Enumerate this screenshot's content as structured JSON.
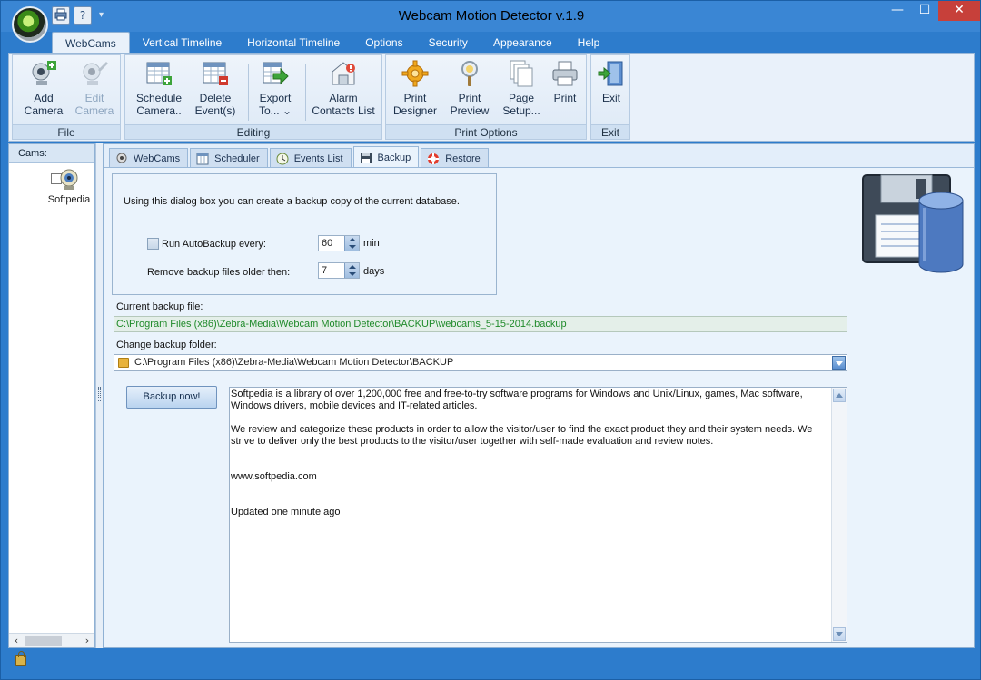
{
  "window": {
    "title": "Webcam Motion Detector v.1.9"
  },
  "quick_access": {
    "print_icon": "printer-icon",
    "help_glyph": "?",
    "dropdown_glyph": "▾"
  },
  "window_controls": {
    "minimize": "—",
    "maximize": "☐",
    "close": "✕"
  },
  "ribbon_tabs": [
    {
      "label": "WebCams",
      "active": true
    },
    {
      "label": "Vertical Timeline",
      "active": false
    },
    {
      "label": "Horizontal Timeline",
      "active": false
    },
    {
      "label": "Options",
      "active": false
    },
    {
      "label": "Security",
      "active": false
    },
    {
      "label": "Appearance",
      "active": false
    },
    {
      "label": "Help",
      "active": false
    }
  ],
  "ribbon": {
    "groups": {
      "file": "File",
      "editing": "Editing",
      "print_options": "Print Options",
      "exit": "Exit"
    },
    "buttons": {
      "add_camera": {
        "line1": "Add",
        "line2": "Camera"
      },
      "edit_camera": {
        "line1": "Edit",
        "line2": "Camera"
      },
      "schedule_camera": {
        "line1": "Schedule",
        "line2": "Camera.."
      },
      "delete_events": {
        "line1": "Delete",
        "line2": "Event(s) ⌄"
      },
      "export_to": {
        "line1": "Export",
        "line2": "To... ⌄"
      },
      "alarm_contacts": {
        "line1": "Alarm",
        "line2": "Contacts List"
      },
      "print_designer": {
        "line1": "Print",
        "line2": "Designer"
      },
      "print_preview": {
        "line1": "Print",
        "line2": "Preview"
      },
      "page_setup": {
        "line1": "Page",
        "line2": "Setup..."
      },
      "print": {
        "line1": "Print",
        "line2": ""
      },
      "exit": {
        "line1": "Exit",
        "line2": ""
      }
    }
  },
  "cams_panel": {
    "header": "Cams:",
    "items": [
      {
        "label": "Softpedia",
        "checked": false
      }
    ],
    "scroll_left": "‹",
    "scroll_right": "›"
  },
  "tabs": [
    {
      "label": "WebCams",
      "active": false
    },
    {
      "label": "Scheduler",
      "active": false
    },
    {
      "label": "Events List",
      "active": false
    },
    {
      "label": "Backup",
      "active": true
    },
    {
      "label": "Restore",
      "active": false
    }
  ],
  "backup": {
    "intro": "Using this dialog box you can create a backup copy of the current database.",
    "autobackup_label": "Run AutoBackup every:",
    "autobackup_checked": false,
    "autobackup_value": "60",
    "autobackup_unit": "min",
    "remove_label": "Remove backup files older then:",
    "remove_value": "7",
    "remove_unit": "days",
    "current_file_label": "Current backup file:",
    "current_file_value": "C:\\Program Files (x86)\\Zebra-Media\\Webcam Motion Detector\\BACKUP\\webcams_5-15-2014.backup",
    "change_folder_label": "Change backup folder:",
    "folder_value": "C:\\Program Files (x86)\\Zebra-Media\\Webcam Motion Detector\\BACKUP",
    "backup_now_label": "Backup now!",
    "notes": "Softpedia is a library of over 1,200,000 free and free-to-try software programs for Windows and Unix/Linux, games, Mac software,\nWindows drivers, mobile devices and IT-related articles.\n\nWe review and categorize these products in order to allow the visitor/user to find the exact product they and their system needs. We\nstrive to deliver only the best products to the visitor/user together with self-made evaluation and review notes.\n\n\nwww.softpedia.com\n\n\nUpdated one minute ago"
  },
  "colors": {
    "frame": "#2d7ccc",
    "ribbon_bg": "#e9f1fa",
    "path_text": "#1f8a2a",
    "close_button": "#c7403a"
  }
}
